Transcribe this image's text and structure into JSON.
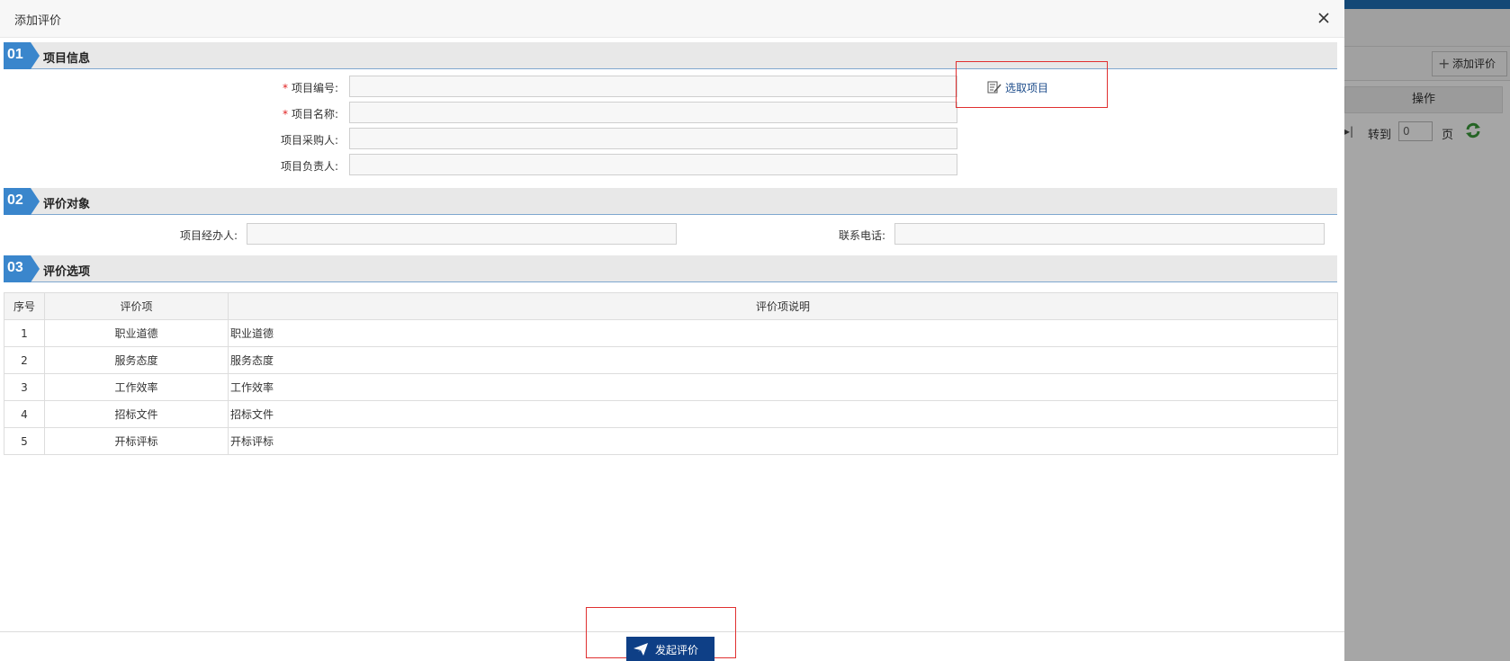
{
  "dialog": {
    "title": "添加评价"
  },
  "sections": [
    {
      "num": "01",
      "title": "项目信息"
    },
    {
      "num": "02",
      "title": "评价对象"
    },
    {
      "num": "03",
      "title": "评价选项"
    }
  ],
  "project_info": {
    "required_mark": "*",
    "code_label": "项目编号:",
    "code_value": "",
    "name_label": "项目名称:",
    "name_value": "",
    "buyer_label": "项目采购人:",
    "buyer_value": "",
    "owner_label": "项目负责人:",
    "owner_value": "",
    "pick_label": "选取项目"
  },
  "target": {
    "agent_label": "项目经办人:",
    "agent_value": "",
    "phone_label": "联系电话:",
    "phone_value": ""
  },
  "options_table": {
    "headers": [
      "序号",
      "评价项",
      "评价项说明"
    ],
    "rows": [
      [
        "1",
        "职业道德",
        "职业道德"
      ],
      [
        "2",
        "服务态度",
        "服务态度"
      ],
      [
        "3",
        "工作效率",
        "工作效率"
      ],
      [
        "4",
        "招标文件",
        "招标文件"
      ],
      [
        "5",
        "开标评标",
        "开标评标"
      ]
    ]
  },
  "footer": {
    "submit_label": "发起评价"
  },
  "background_app": {
    "add_button_label": "添加评价",
    "column_header": "操作",
    "pager_goto": "转到",
    "pager_value": "0",
    "pager_page": "页"
  },
  "colors": {
    "section_badge": "#3a86cc",
    "submit_bg": "#0e3f86",
    "required": "#e02020",
    "highlight_box": "#e03030"
  }
}
